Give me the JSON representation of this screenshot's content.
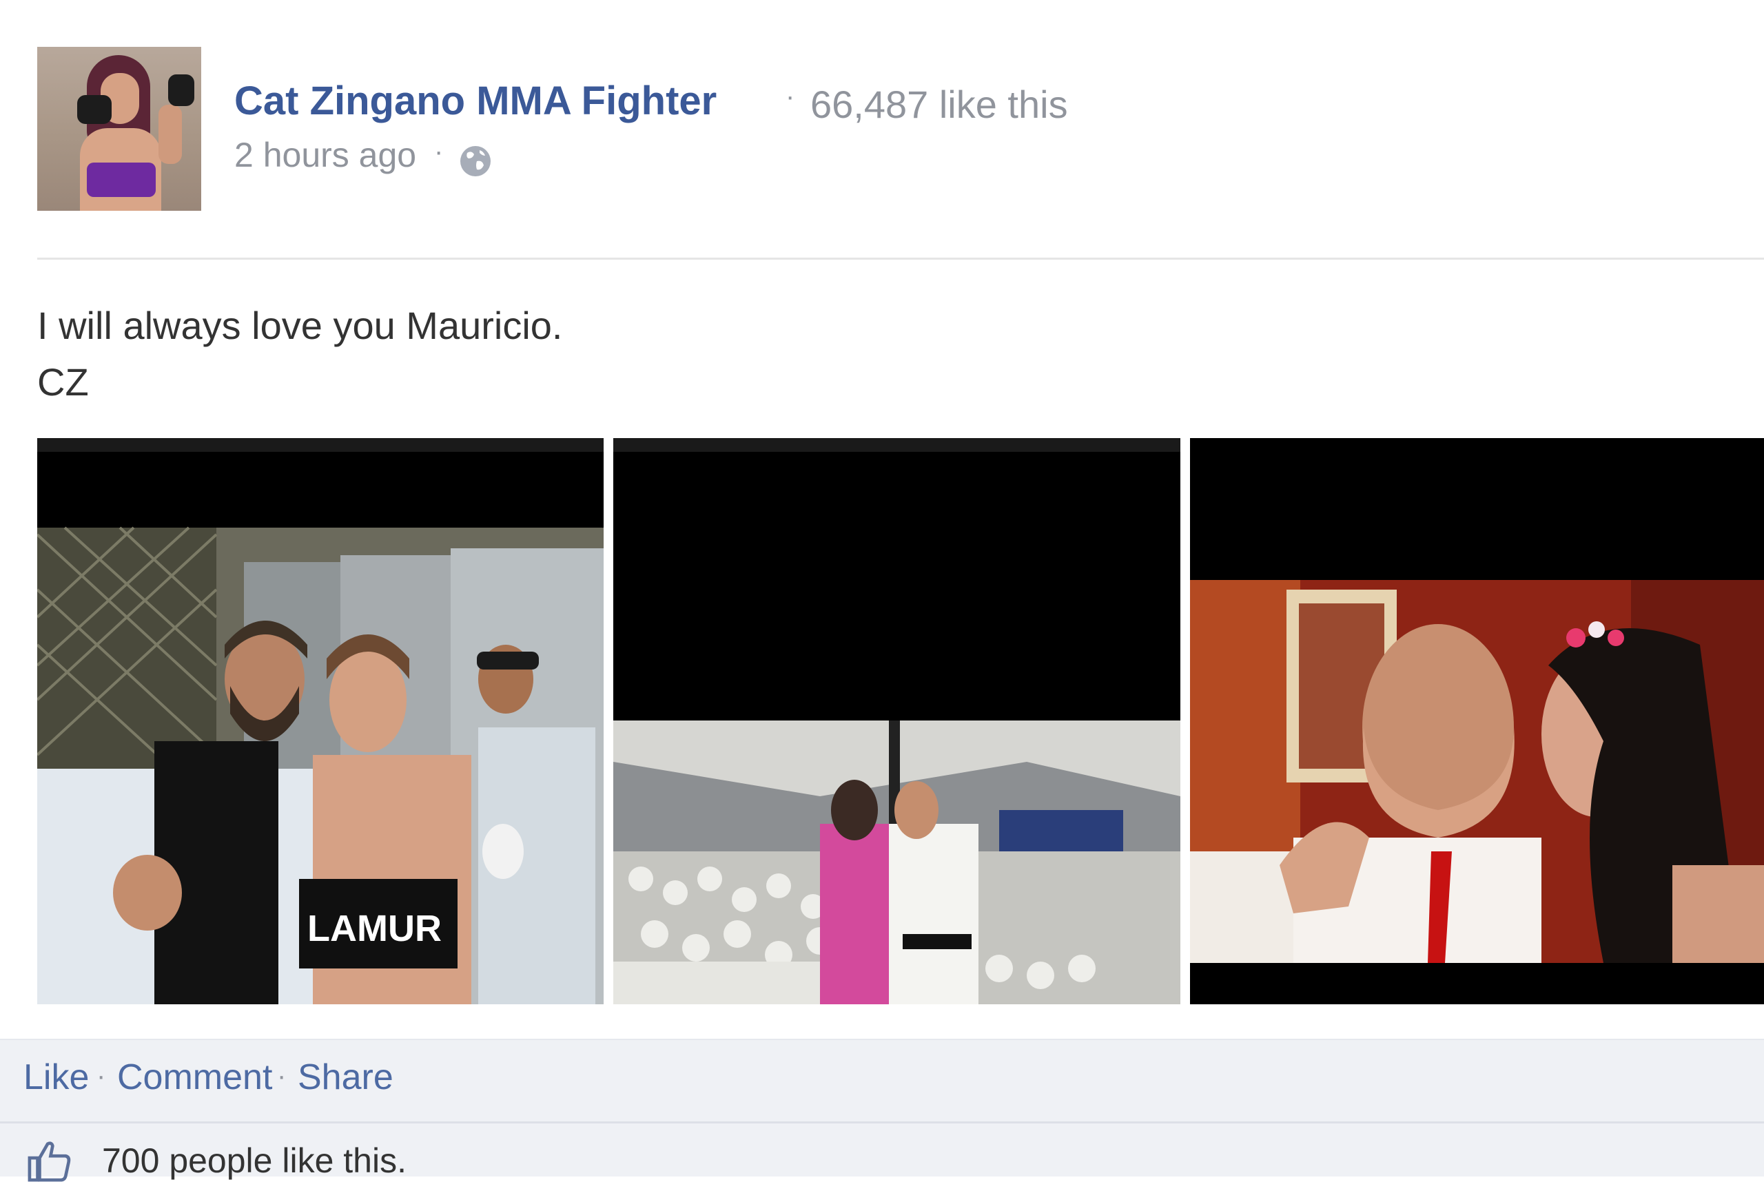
{
  "post": {
    "author": "Cat Zingano MMA Fighter",
    "separator": "·",
    "likes": "66,487 like this",
    "time": "2 hours ago",
    "message_line1": "I will always love you Mauricio.",
    "message_line2": "CZ"
  },
  "actions": {
    "like": "Like",
    "comment": "Comment",
    "share": "Share",
    "separator": "·"
  },
  "summary": {
    "likes_text": "700 people like this."
  },
  "photos": [
    {
      "shirt_text": "LAMUR"
    },
    {},
    {}
  ],
  "icons": {
    "globe": "globe-icon",
    "thumb": "thumbs-up-icon"
  },
  "colors": {
    "link_blue": "#3b5998",
    "meta_gray": "#90949c",
    "footer_bg": "#eff1f5"
  }
}
